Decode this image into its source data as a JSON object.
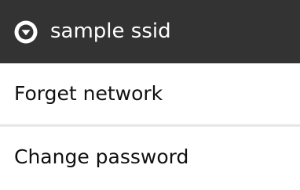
{
  "dialog": {
    "title": "sample ssid",
    "title_icon": "dropdown-arrow-icon",
    "items": [
      {
        "label": "Forget network"
      },
      {
        "label": "Change password"
      }
    ]
  },
  "colors": {
    "title_bar_background": "#333333",
    "title_text": "#FFFFFF",
    "menu_background": "#FFFFFF",
    "menu_text": "#101010",
    "divider": "#E6E6E6"
  }
}
